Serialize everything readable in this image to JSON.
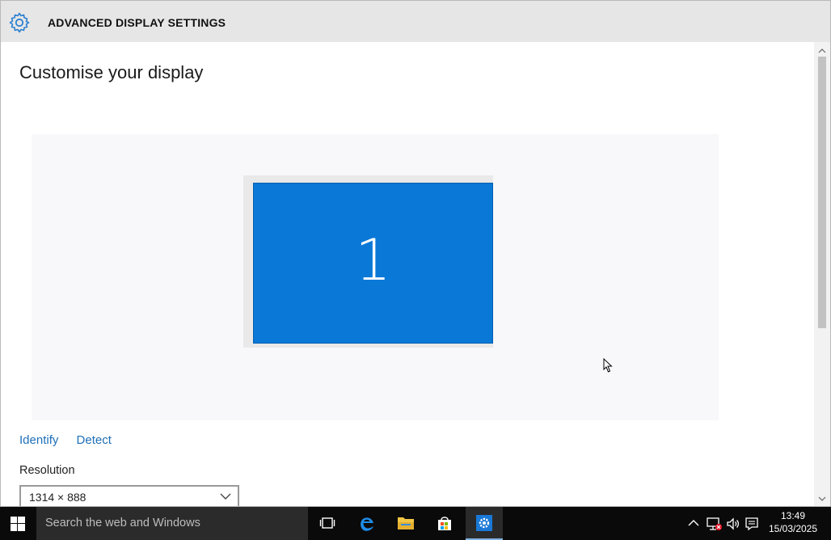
{
  "window": {
    "title": "ADVANCED DISPLAY SETTINGS"
  },
  "main": {
    "heading": "Customise your display",
    "monitor_number": "1",
    "links": {
      "identify": "Identify",
      "detect": "Detect"
    },
    "resolution": {
      "label": "Resolution",
      "value": "1314 × 888"
    }
  },
  "taskbar": {
    "search_placeholder": "Search the web and Windows",
    "time": "13:49",
    "date": "15/03/2025"
  },
  "colors": {
    "accent": "#0a78d7",
    "link": "#1e6fb8",
    "taskbar": "#0a0a0a"
  },
  "icons": [
    "gear-icon",
    "windows-logo-icon",
    "task-view-icon",
    "edge-icon",
    "file-explorer-icon",
    "store-icon",
    "settings-icon",
    "chevron-up-icon",
    "network-icon",
    "volume-icon",
    "notifications-icon"
  ]
}
